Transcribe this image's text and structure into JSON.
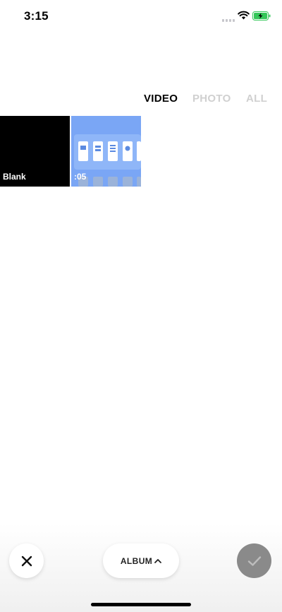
{
  "status_bar": {
    "time": "3:15",
    "icons": [
      "signal-icon",
      "wifi-icon",
      "battery-charging-icon"
    ],
    "battery_color": "#34c759"
  },
  "tabs": [
    {
      "label": "VIDEO",
      "selected": true
    },
    {
      "label": "PHOTO",
      "selected": false
    },
    {
      "label": "ALL",
      "selected": false
    }
  ],
  "grid": [
    {
      "label": "Blank",
      "background": "#000000"
    },
    {
      "label": ":05",
      "background": "#7aa6f5"
    }
  ],
  "bottom_bar": {
    "album_label": "ALBUM",
    "close_icon": "close-icon",
    "album_icon": "chevron-up-icon",
    "confirm_icon": "checkmark-icon",
    "confirm_color": "#8a8a8a"
  }
}
